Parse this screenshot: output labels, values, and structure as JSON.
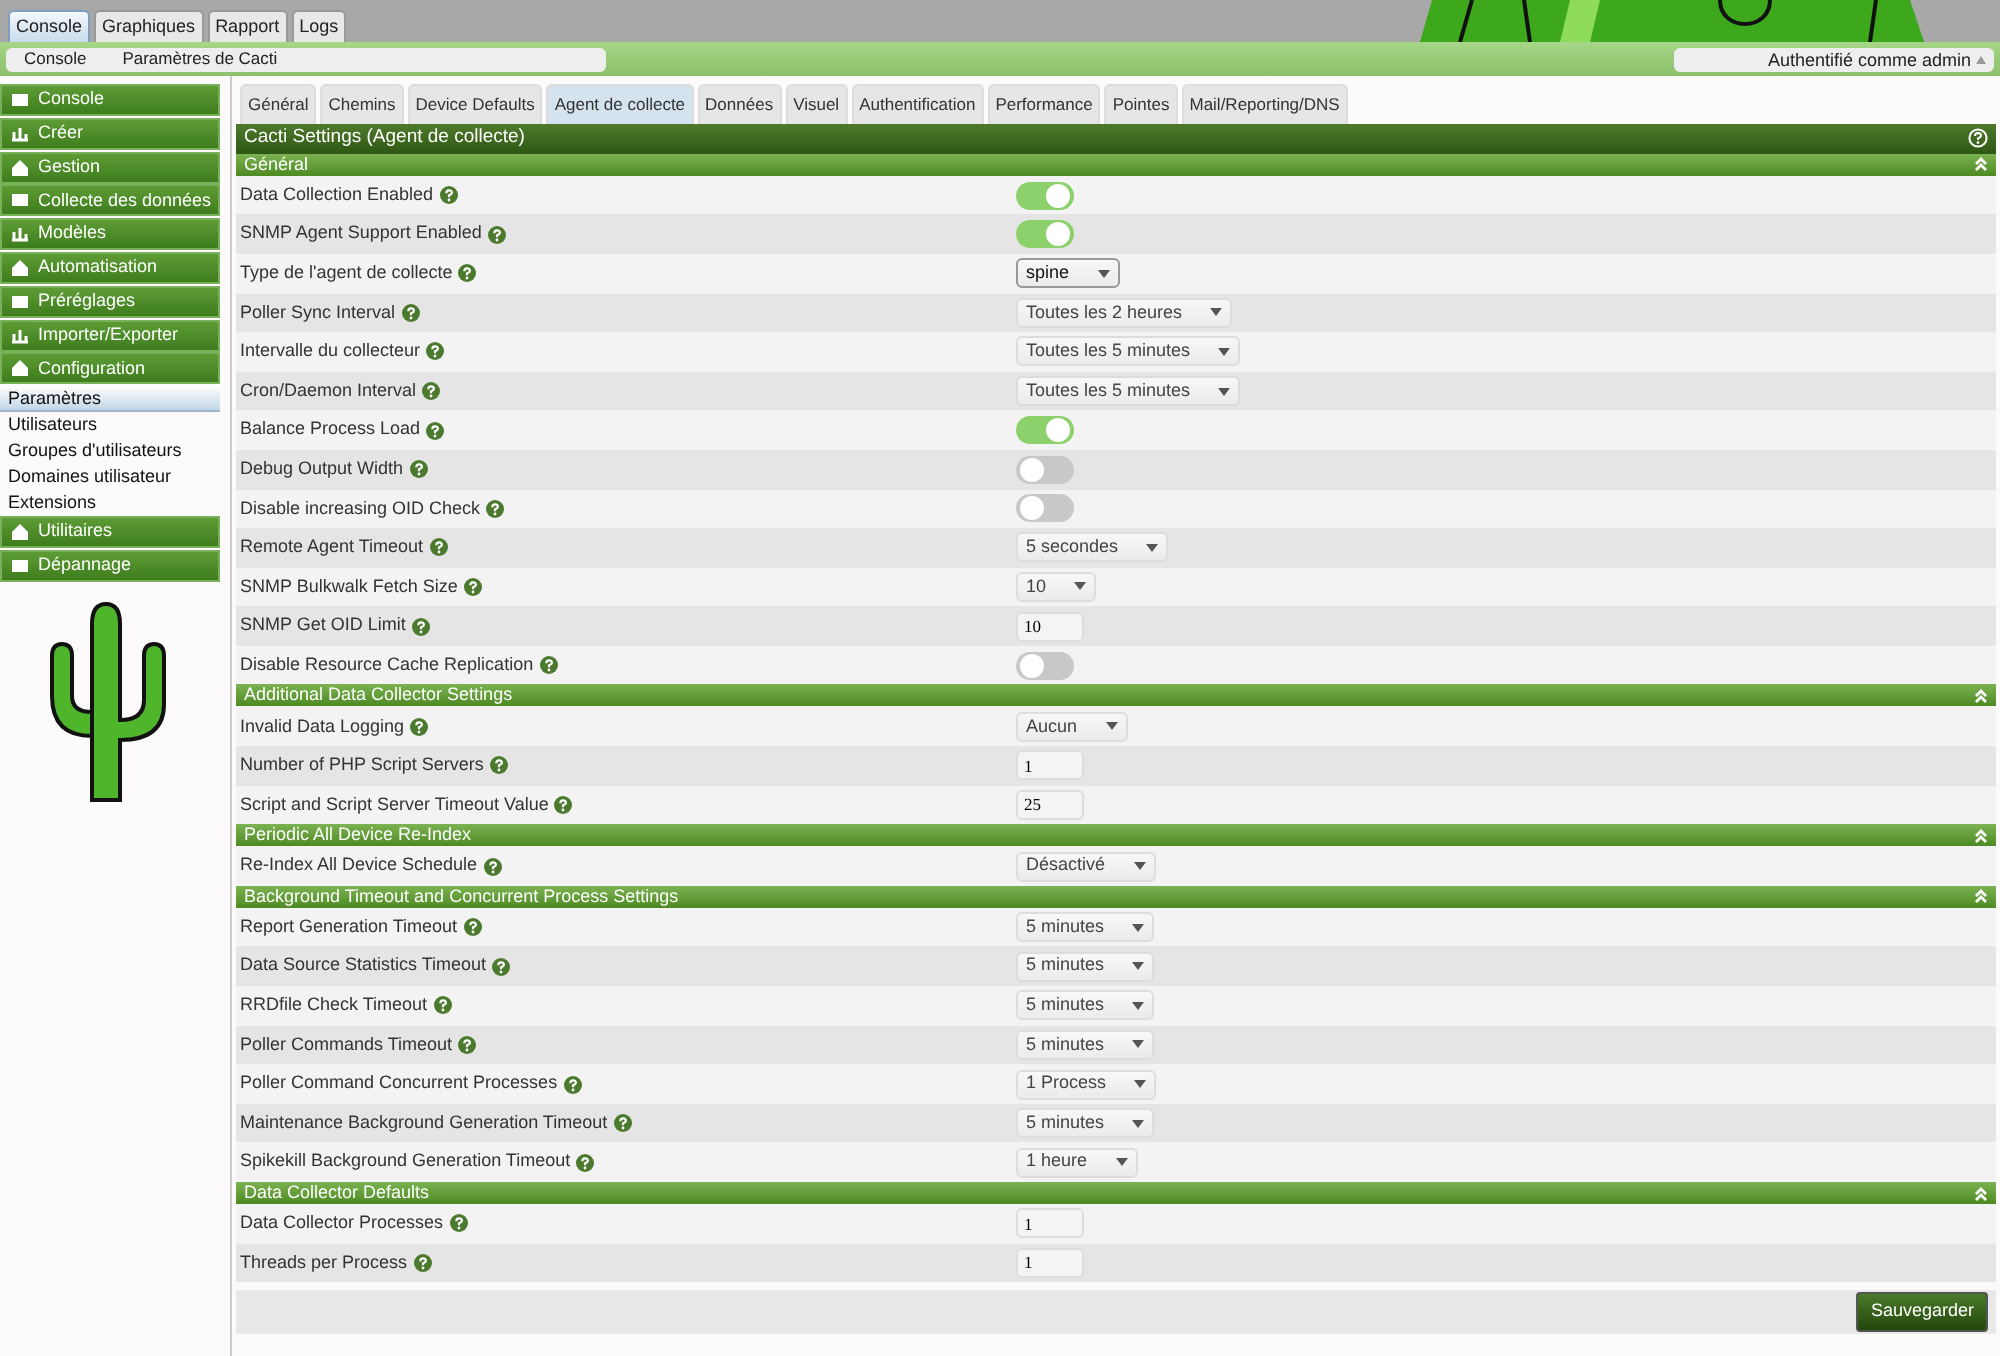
{
  "top_tabs": [
    {
      "label": "Console",
      "selected": true
    },
    {
      "label": "Graphiques",
      "selected": false
    },
    {
      "label": "Rapport",
      "selected": false
    },
    {
      "label": "Logs",
      "selected": false
    }
  ],
  "breadcrumb": [
    "Console",
    "Paramètres de Cacti"
  ],
  "user_menu": "Authentifié comme admin",
  "sidebar": [
    {
      "label": "Console",
      "kind": "header"
    },
    {
      "label": "Créer",
      "kind": "header"
    },
    {
      "label": "Gestion",
      "kind": "header"
    },
    {
      "label": "Collecte des données",
      "kind": "header"
    },
    {
      "label": "Modèles",
      "kind": "header"
    },
    {
      "label": "Automatisation",
      "kind": "header"
    },
    {
      "label": "Préréglages",
      "kind": "header"
    },
    {
      "label": "Importer/Exporter",
      "kind": "header"
    },
    {
      "label": "Configuration",
      "kind": "header"
    },
    {
      "label": "Paramètres",
      "kind": "link",
      "selected": true
    },
    {
      "label": "Utilisateurs",
      "kind": "link",
      "selected": false
    },
    {
      "label": "Groupes d'utilisateurs",
      "kind": "link",
      "selected": false
    },
    {
      "label": "Domaines utilisateur",
      "kind": "link",
      "selected": false
    },
    {
      "label": "Extensions",
      "kind": "link",
      "selected": false
    },
    {
      "label": "Utilitaires",
      "kind": "header"
    },
    {
      "label": "Dépannage",
      "kind": "header"
    }
  ],
  "settings_tabs": [
    {
      "label": "Général",
      "selected": false
    },
    {
      "label": "Chemins",
      "selected": false
    },
    {
      "label": "Device Defaults",
      "selected": false
    },
    {
      "label": "Agent de collecte",
      "selected": true
    },
    {
      "label": "Données",
      "selected": false
    },
    {
      "label": "Visuel",
      "selected": false
    },
    {
      "label": "Authentification",
      "selected": false
    },
    {
      "label": "Performance",
      "selected": false
    },
    {
      "label": "Pointes",
      "selected": false
    },
    {
      "label": "Mail/Reporting/DNS",
      "selected": false
    }
  ],
  "panel_title": "Cacti Settings (Agent de collecte)",
  "sections": [
    {
      "title": "Général",
      "fields": [
        {
          "label": "Data Collection Enabled",
          "kind": "toggle",
          "on": true
        },
        {
          "label": "SNMP Agent Support Enabled",
          "kind": "toggle",
          "on": true
        },
        {
          "label": "Type de l'agent de collecte",
          "kind": "select",
          "value": "spine"
        },
        {
          "label": "Poller Sync Interval",
          "kind": "select",
          "value": "Toutes les 2 heures"
        },
        {
          "label": "Intervalle du collecteur",
          "kind": "select",
          "value": "Toutes les 5 minutes"
        },
        {
          "label": "Cron/Daemon Interval",
          "kind": "select",
          "value": "Toutes les 5 minutes"
        },
        {
          "label": "Balance Process Load",
          "kind": "toggle",
          "on": true
        },
        {
          "label": "Debug Output Width",
          "kind": "toggle",
          "on": false
        },
        {
          "label": "Disable increasing OID Check",
          "kind": "toggle",
          "on": false
        },
        {
          "label": "Remote Agent Timeout",
          "kind": "select",
          "value": "5 secondes"
        },
        {
          "label": "SNMP Bulkwalk Fetch Size",
          "kind": "select",
          "value": "10"
        },
        {
          "label": "SNMP Get OID Limit",
          "kind": "text",
          "value": "10"
        },
        {
          "label": "Disable Resource Cache Replication",
          "kind": "toggle",
          "on": false
        }
      ]
    },
    {
      "title": "Additional Data Collector Settings",
      "fields": [
        {
          "label": "Invalid Data Logging",
          "kind": "select",
          "value": "Aucun"
        },
        {
          "label": "Number of PHP Script Servers",
          "kind": "text",
          "value": "1"
        },
        {
          "label": "Script and Script Server Timeout Value",
          "kind": "text",
          "value": "25"
        }
      ]
    },
    {
      "title": "Periodic All Device Re-Index",
      "fields": [
        {
          "label": "Re-Index All Device Schedule",
          "kind": "select",
          "value": "Désactivé"
        }
      ]
    },
    {
      "title": "Background Timeout and Concurrent Process Settings",
      "fields": [
        {
          "label": "Report Generation Timeout",
          "kind": "select",
          "value": "5 minutes"
        },
        {
          "label": "Data Source Statistics Timeout",
          "kind": "select",
          "value": "5 minutes"
        },
        {
          "label": "RRDfile Check Timeout",
          "kind": "select",
          "value": "5 minutes"
        },
        {
          "label": "Poller Commands Timeout",
          "kind": "select",
          "value": "5 minutes"
        },
        {
          "label": "Poller Command Concurrent Processes",
          "kind": "select",
          "value": "1 Process"
        },
        {
          "label": "Maintenance Background Generation Timeout",
          "kind": "select",
          "value": "5 minutes"
        },
        {
          "label": "Spikekill Background Generation Timeout",
          "kind": "select",
          "value": "1 heure"
        }
      ]
    },
    {
      "title": "Data Collector Defaults",
      "fields": [
        {
          "label": "Data Collector Processes",
          "kind": "text",
          "value": "1"
        },
        {
          "label": "Threads per Process",
          "kind": "text",
          "value": "1"
        }
      ]
    }
  ],
  "save_button": "Sauvegarder"
}
